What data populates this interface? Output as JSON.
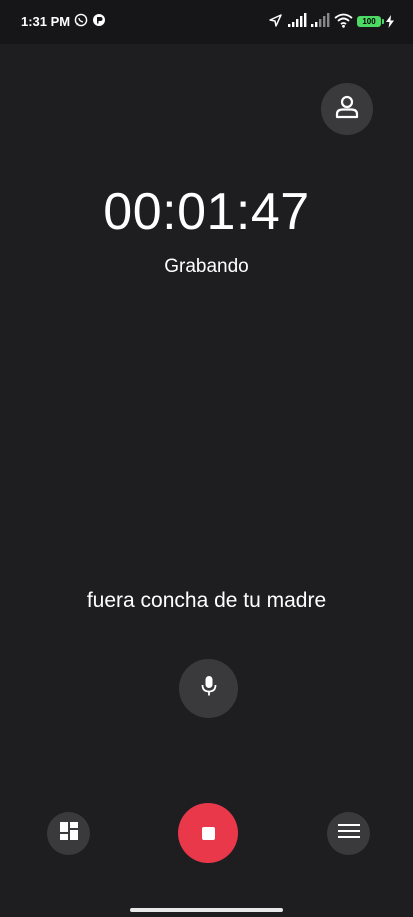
{
  "status_bar": {
    "time": "1:31 PM",
    "battery_level": "100",
    "icons": [
      "whatsapp-icon",
      "notification-icon",
      "location-arrow-icon",
      "signal-icon",
      "signal-icon",
      "wifi-icon",
      "battery-icon",
      "charging-icon"
    ]
  },
  "recorder": {
    "timer": "00:01:47",
    "status": "Grabando",
    "transcript": "fuera concha de tu madre"
  },
  "controls": {
    "contact_icon": "person-icon",
    "mic_icon": "microphone-icon",
    "gallery_icon": "grid-icon",
    "stop_icon": "stop-icon",
    "menu_icon": "menu-icon"
  },
  "colors": {
    "background": "#1e1e20",
    "button_bg": "#3a3a3c",
    "stop_red": "#e8384a",
    "battery_green": "#4cd964"
  }
}
